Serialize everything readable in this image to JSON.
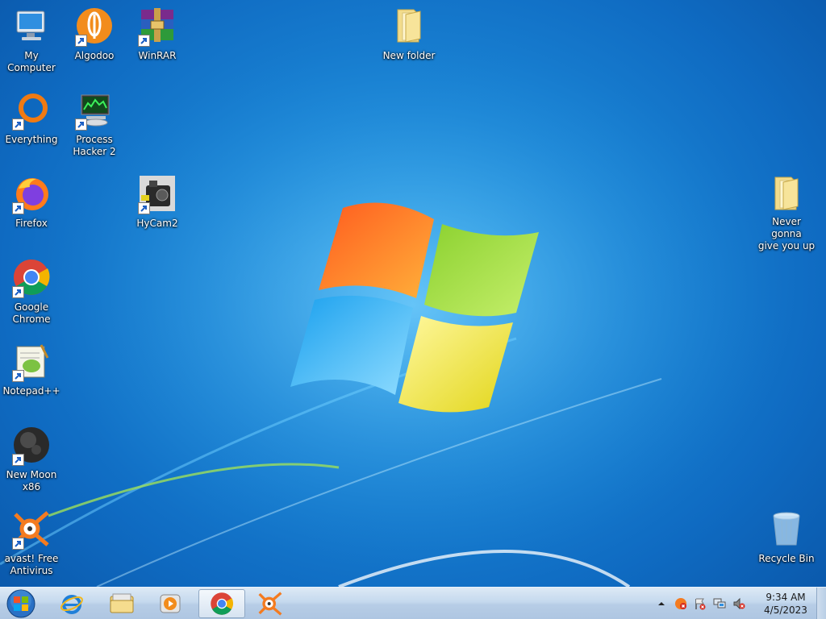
{
  "desktop": {
    "icons": [
      {
        "label": "My Computer",
        "icon": "computer-icon",
        "shortcut": false
      },
      {
        "label": "Algodoo",
        "icon": "algodoo-icon",
        "shortcut": true
      },
      {
        "label": "WinRAR",
        "icon": "winrar-icon",
        "shortcut": true
      },
      {
        "label": "New folder",
        "icon": "folder-icon",
        "shortcut": false
      },
      {
        "label": "Everything",
        "icon": "everything-icon",
        "shortcut": true
      },
      {
        "label": "Process\nHacker 2",
        "icon": "process-hacker-icon",
        "shortcut": true
      },
      {
        "label": "Firefox",
        "icon": "firefox-icon",
        "shortcut": true
      },
      {
        "label": "HyCam2",
        "icon": "hycam-icon",
        "shortcut": true
      },
      {
        "label": "Never gonna\ngive you up",
        "icon": "folder-icon",
        "shortcut": false
      },
      {
        "label": "Google\nChrome",
        "icon": "chrome-icon",
        "shortcut": true
      },
      {
        "label": "Notepad++",
        "icon": "notepadpp-icon",
        "shortcut": true
      },
      {
        "label": "New Moon\nx86",
        "icon": "new-moon-icon",
        "shortcut": true
      },
      {
        "label": "avast! Free\nAntivirus",
        "icon": "avast-icon",
        "shortcut": true
      },
      {
        "label": "Recycle Bin",
        "icon": "recycle-bin-icon",
        "shortcut": false
      }
    ]
  },
  "taskbar": {
    "start": {
      "icon": "windows-logo-icon"
    },
    "pinned": [
      {
        "icon": "internet-explorer-icon",
        "active": false
      },
      {
        "icon": "file-explorer-icon",
        "active": false
      },
      {
        "icon": "media-player-icon",
        "active": false
      },
      {
        "icon": "chrome-icon",
        "active": true
      },
      {
        "icon": "avast-icon",
        "active": false
      }
    ],
    "tray": {
      "icons": [
        "show-hidden-icons-icon",
        "avast-tray-icon",
        "action-center-icon",
        "network-icon",
        "volume-muted-icon"
      ],
      "time": "9:34 AM",
      "date": "4/5/2023"
    }
  },
  "colors": {
    "wallpaper_blue": "#1b86d6",
    "taskbar": "#c5d9ee",
    "label_text": "#ffffff"
  }
}
